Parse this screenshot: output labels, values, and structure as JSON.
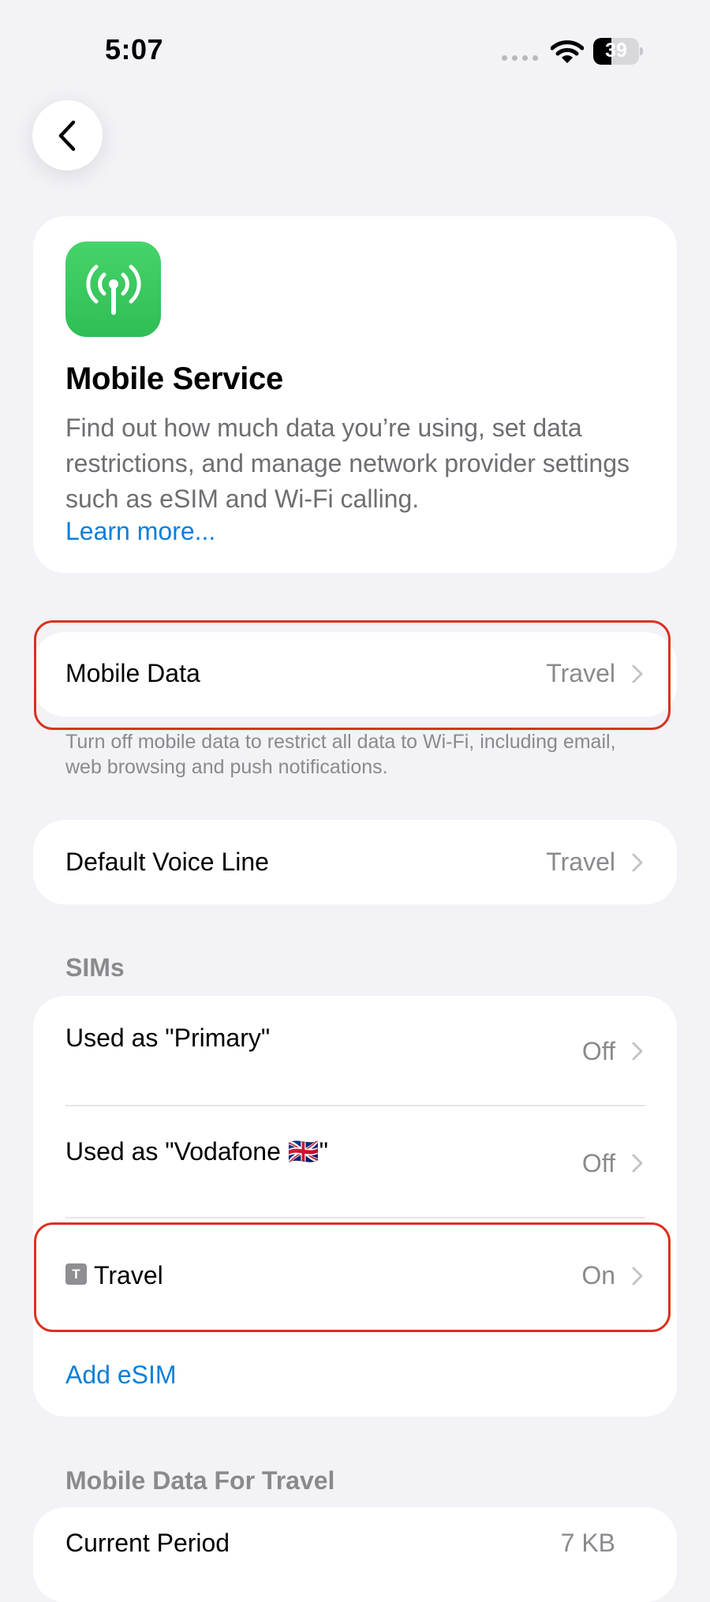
{
  "status_bar": {
    "time": "5:07",
    "battery_level": "39",
    "battery_fraction": 0.39
  },
  "hero": {
    "title": "Mobile Service",
    "description": "Find out how much data you’re using, set data restrictions, and manage network provider settings such as eSIM and Wi-Fi calling.",
    "learn_more": "Learn more..."
  },
  "mobile_data": {
    "label": "Mobile Data",
    "value": "Travel",
    "footer": "Turn off mobile data to restrict all data to Wi-Fi, including email, web browsing and push notifications."
  },
  "default_voice_line": {
    "label": "Default Voice Line",
    "value": "Travel"
  },
  "sims": {
    "header": "SIMs",
    "items": [
      {
        "label": "Used as \"Primary\"",
        "value": "Off"
      },
      {
        "label": "Used as \"Vodafone 🇬🇧\"",
        "value": "Off"
      },
      {
        "badge": "T",
        "label": "Travel",
        "value": "On"
      }
    ],
    "add_esim": "Add eSIM"
  },
  "mobile_data_for_travel": {
    "header": "Mobile Data For Travel",
    "current_period": {
      "label": "Current Period",
      "value": "7 KB"
    }
  },
  "colors": {
    "accent": "#0a7fd9",
    "highlight": "#d9321f",
    "app_icon": "#34c759"
  }
}
